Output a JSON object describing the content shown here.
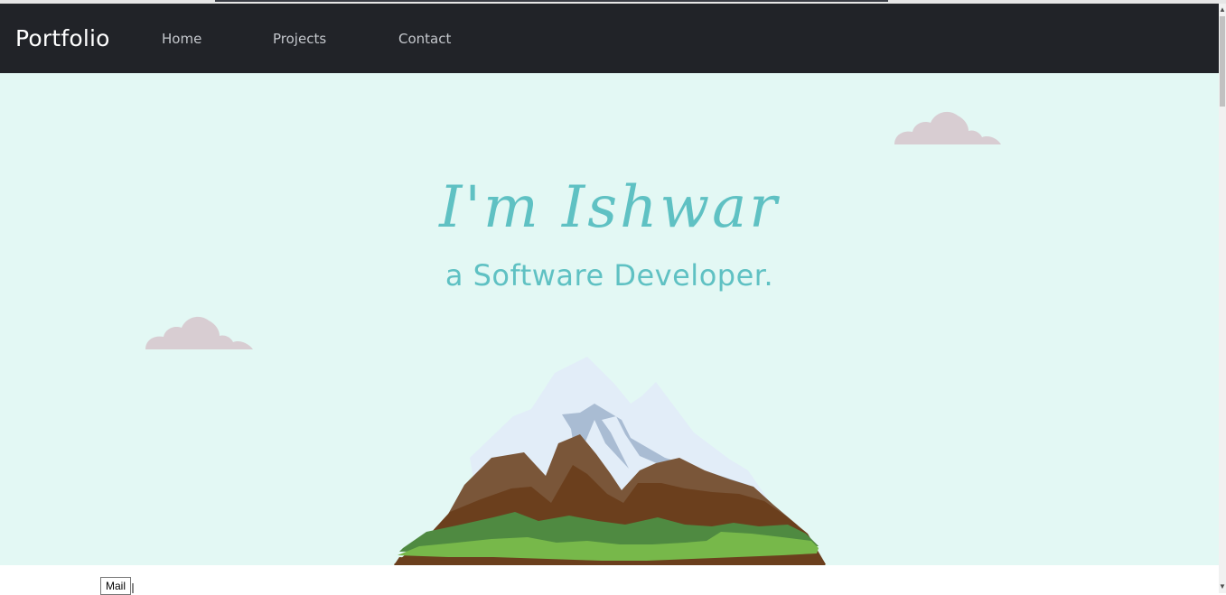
{
  "navbar": {
    "brand": "Portfolio",
    "links": [
      "Home",
      "Projects",
      "Contact"
    ]
  },
  "hero": {
    "name": "I'm Ishwar",
    "role": "a Software Developer."
  },
  "tooltip": {
    "mail": "Mail"
  },
  "icons": {
    "cloud": "cloud-icon",
    "mountain": "mountain-illustration"
  },
  "colors": {
    "navbar_bg": "#212328",
    "hero_bg": "#e3f8f4",
    "accent": "#5fc1c3",
    "cloud": "#d8cdd2"
  }
}
